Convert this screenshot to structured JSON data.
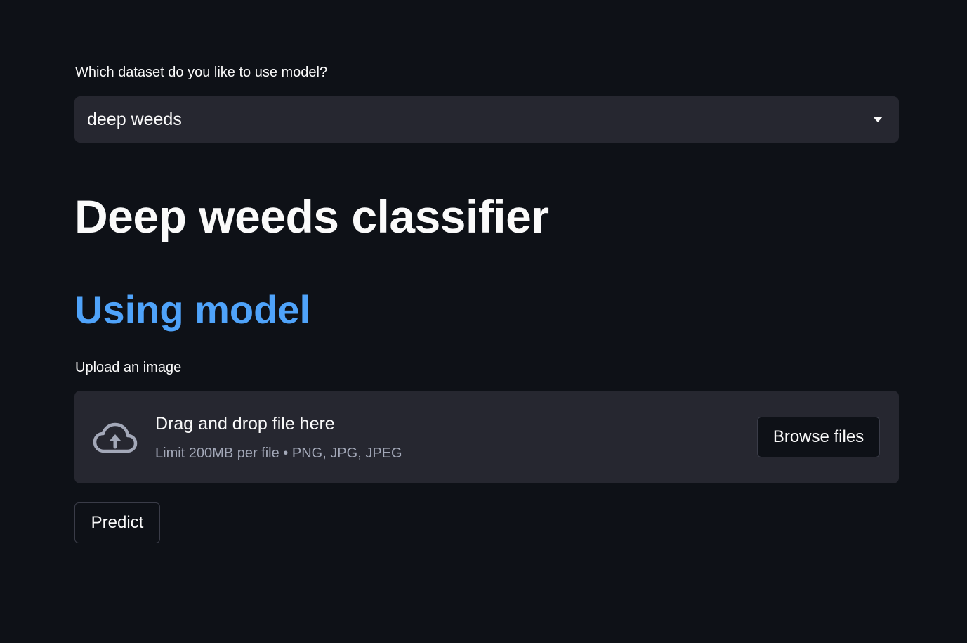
{
  "dataset_select": {
    "label": "Which dataset do you like to use model?",
    "selected_value": "deep weeds",
    "arrow_icon": "caret-down-icon"
  },
  "page_title": "Deep weeds classifier",
  "section_title": "Using model",
  "uploader": {
    "label": "Upload an image",
    "drop_title": "Drag and drop file here",
    "drop_subtitle": "Limit 200MB per file • PNG, JPG, JPEG",
    "icon": "cloud-upload-icon",
    "browse_label": "Browse files"
  },
  "predict_label": "Predict",
  "colors": {
    "background": "#0e1117",
    "widget_background": "#262730",
    "accent_blue": "#4fa3fa",
    "text": "#fafafa",
    "muted_text": "#a3a8b8"
  }
}
